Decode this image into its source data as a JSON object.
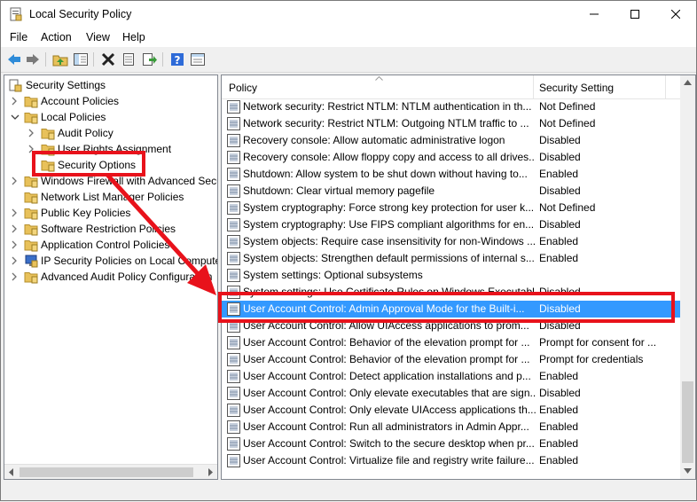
{
  "window": {
    "title": "Local Security Policy"
  },
  "menu": [
    "File",
    "Action",
    "View",
    "Help"
  ],
  "tree": {
    "root": "Security Settings",
    "items": [
      {
        "label": "Account Policies"
      },
      {
        "label": "Local Policies"
      },
      {
        "label": "Audit Policy"
      },
      {
        "label": "User Rights Assignment"
      },
      {
        "label": "Security Options"
      },
      {
        "label": "Windows Firewall with Advanced Secu"
      },
      {
        "label": "Network List Manager Policies"
      },
      {
        "label": "Public Key Policies"
      },
      {
        "label": "Software Restriction Policies"
      },
      {
        "label": "Application Control Policies"
      },
      {
        "label": "IP Security Policies on Local Compute"
      },
      {
        "label": "Advanced Audit Policy Configuration"
      }
    ]
  },
  "list": {
    "columns": {
      "policy": "Policy",
      "setting": "Security Setting"
    },
    "rows": [
      {
        "policy": "Network security: Restrict NTLM: NTLM authentication in th...",
        "setting": "Not Defined"
      },
      {
        "policy": "Network security: Restrict NTLM: Outgoing NTLM traffic to ...",
        "setting": "Not Defined"
      },
      {
        "policy": "Recovery console: Allow automatic administrative logon",
        "setting": "Disabled"
      },
      {
        "policy": "Recovery console: Allow floppy copy and access to all drives...",
        "setting": "Disabled"
      },
      {
        "policy": "Shutdown: Allow system to be shut down without having to...",
        "setting": "Enabled"
      },
      {
        "policy": "Shutdown: Clear virtual memory pagefile",
        "setting": "Disabled"
      },
      {
        "policy": "System cryptography: Force strong key protection for user k...",
        "setting": "Not Defined"
      },
      {
        "policy": "System cryptography: Use FIPS compliant algorithms for en...",
        "setting": "Disabled"
      },
      {
        "policy": "System objects: Require case insensitivity for non-Windows ...",
        "setting": "Enabled"
      },
      {
        "policy": "System objects: Strengthen default permissions of internal s...",
        "setting": "Enabled"
      },
      {
        "policy": "System settings: Optional subsystems",
        "setting": ""
      },
      {
        "policy": "System settings: Use Certificate Rules on Windows Executabl...",
        "setting": "Disabled"
      },
      {
        "policy": "User Account Control: Admin Approval Mode for the Built-i...",
        "setting": "Disabled"
      },
      {
        "policy": "User Account Control: Allow UIAccess applications to prom...",
        "setting": "Disabled"
      },
      {
        "policy": "User Account Control: Behavior of the elevation prompt for ...",
        "setting": "Prompt for consent for ..."
      },
      {
        "policy": "User Account Control: Behavior of the elevation prompt for ...",
        "setting": "Prompt for credentials"
      },
      {
        "policy": "User Account Control: Detect application installations and p...",
        "setting": "Enabled"
      },
      {
        "policy": "User Account Control: Only elevate executables that are sign...",
        "setting": "Disabled"
      },
      {
        "policy": "User Account Control: Only elevate UIAccess applications th...",
        "setting": "Enabled"
      },
      {
        "policy": "User Account Control: Run all administrators in Admin Appr...",
        "setting": "Enabled"
      },
      {
        "policy": "User Account Control: Switch to the secure desktop when pr...",
        "setting": "Enabled"
      },
      {
        "policy": "User Account Control: Virtualize file and registry write failure...",
        "setting": "Enabled"
      }
    ]
  },
  "colors": {
    "selection": "#3399ff",
    "highlight": "#e8121b",
    "folder": "#e8c15a"
  },
  "icons": [
    "back-icon",
    "forward-icon",
    "up-folder-icon",
    "show-hide-tree-icon",
    "delete-icon",
    "properties-icon",
    "export-icon",
    "help-icon",
    "view-icon"
  ]
}
